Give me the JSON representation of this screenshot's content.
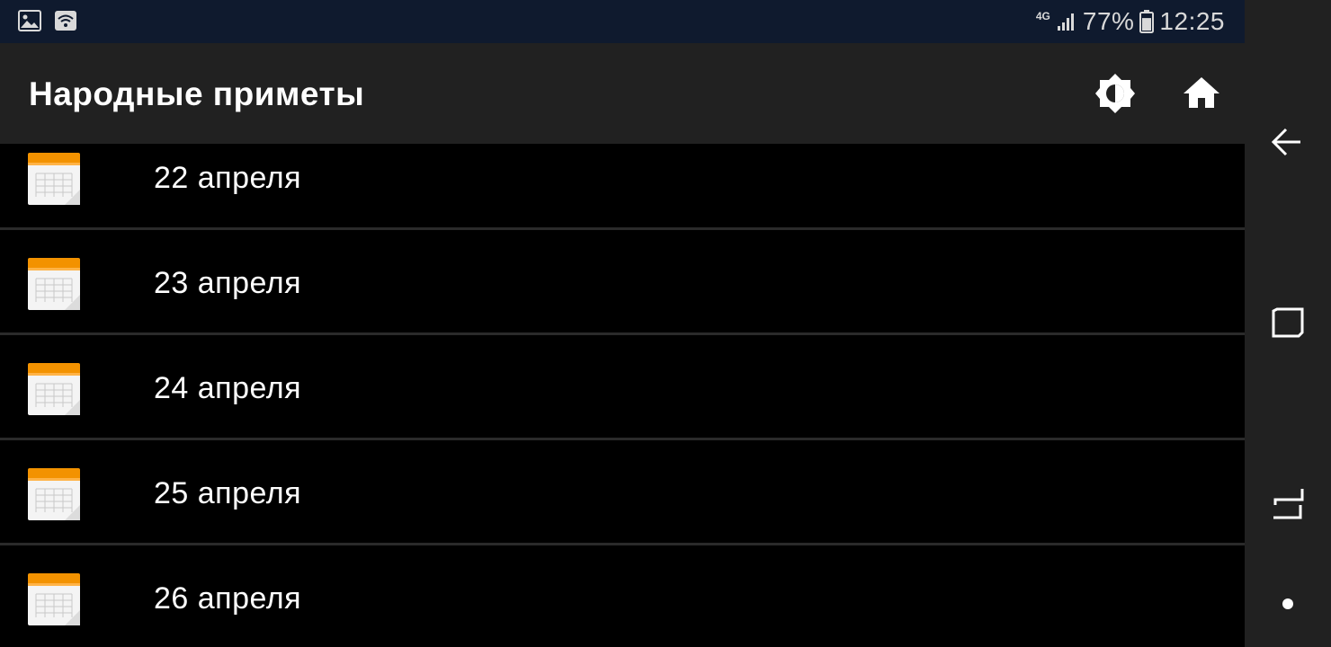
{
  "status_bar": {
    "network": "4G",
    "battery_percent": "77%",
    "time": "12:25",
    "battery_level": 0.77,
    "left_icons": [
      "gallery-icon",
      "wifi-icon"
    ],
    "right_icons": [
      "signal-icon",
      "battery-icon"
    ]
  },
  "app_bar": {
    "title": "Народные приметы",
    "actions": [
      {
        "name": "theme-toggle-button",
        "icon": "brightness-icon"
      },
      {
        "name": "home-button",
        "icon": "home-icon"
      }
    ]
  },
  "list": {
    "items": [
      {
        "label": "22 апреля",
        "icon": "calendar-icon"
      },
      {
        "label": "23 апреля",
        "icon": "calendar-icon"
      },
      {
        "label": "24 апреля",
        "icon": "calendar-icon"
      },
      {
        "label": "25 апреля",
        "icon": "calendar-icon"
      },
      {
        "label": "26 апреля",
        "icon": "calendar-icon"
      }
    ]
  },
  "nav_bar": {
    "buttons": [
      "back-icon",
      "overview-icon",
      "recents-icon",
      "home-dot-icon"
    ]
  },
  "colors": {
    "status_bar_bg": "#0f1a2e",
    "app_bar_bg": "#212121",
    "list_bg": "#000000",
    "divider": "#2a2a2a",
    "calendar_accent": "#f39200",
    "text": "#ffffff"
  }
}
